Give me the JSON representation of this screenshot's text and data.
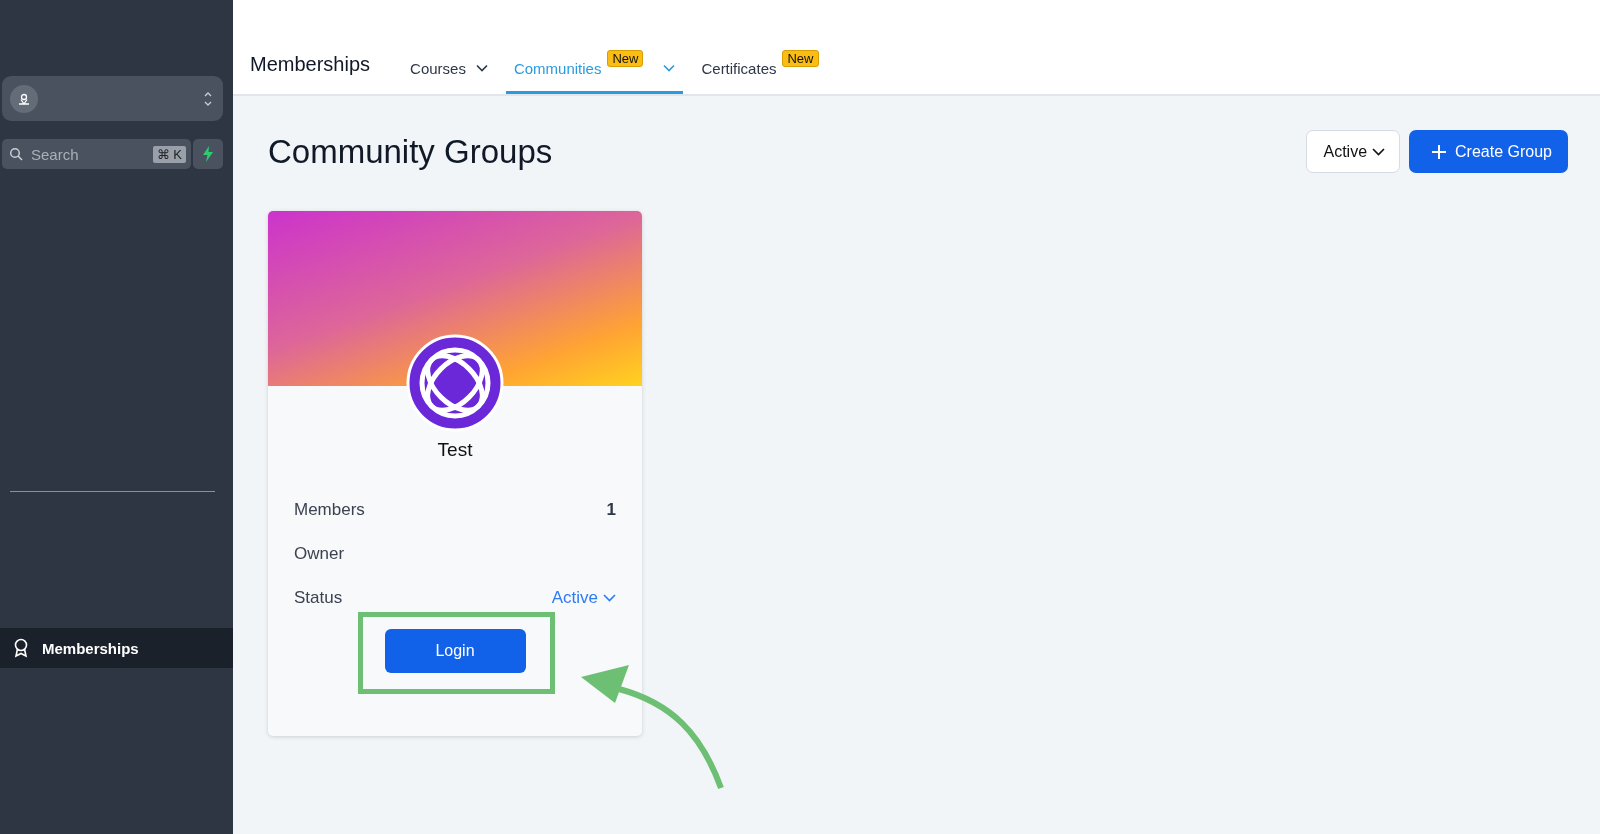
{
  "sidebar": {
    "search": {
      "placeholder": "Search",
      "shortcut": "⌘ K"
    },
    "items": [
      {
        "label": "Memberships",
        "selected": true
      }
    ]
  },
  "topbar": {
    "title": "Memberships",
    "tabs": [
      {
        "label": "Courses",
        "dropdown": true,
        "selected": false
      },
      {
        "label": "Communities",
        "badge": "New",
        "dropdown": true,
        "selected": true
      },
      {
        "label": "Certificates",
        "badge": "New",
        "dropdown": false,
        "selected": false
      }
    ]
  },
  "page": {
    "title": "Community Groups",
    "filter": "Active",
    "create_button": "Create Group"
  },
  "card": {
    "name": "Test",
    "rows": [
      {
        "label": "Members",
        "value": "1",
        "kind": "text"
      },
      {
        "label": "Owner",
        "kind": "text"
      },
      {
        "label": "Status",
        "value": "Active",
        "kind": "dropdown"
      }
    ],
    "button": "Login"
  }
}
